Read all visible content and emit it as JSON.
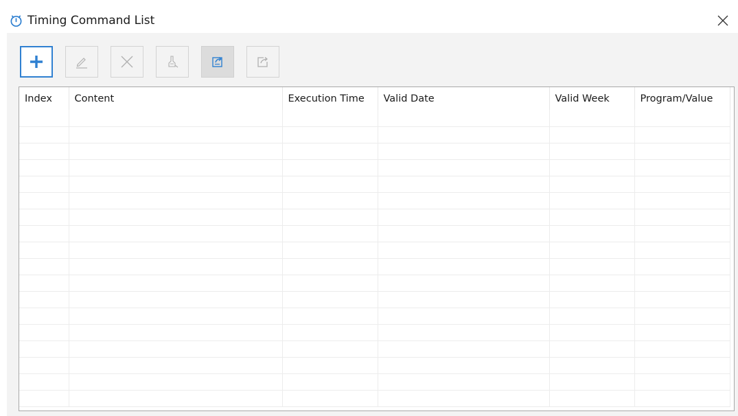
{
  "window": {
    "title": "Timing Command List",
    "close_label": "×"
  },
  "toolbar": {
    "buttons": [
      {
        "icon": "plus-icon",
        "state": "enabled-primary"
      },
      {
        "icon": "pencil-edit-icon",
        "state": "disabled"
      },
      {
        "icon": "delete-x-icon",
        "state": "disabled"
      },
      {
        "icon": "clear-brush-icon",
        "state": "disabled"
      },
      {
        "icon": "import-icon",
        "state": "active"
      },
      {
        "icon": "export-icon",
        "state": "disabled"
      }
    ]
  },
  "table": {
    "columns": [
      "Index",
      "Content",
      "Execution Time",
      "Valid Date",
      "Valid Week",
      "Program/Value"
    ],
    "rows": []
  },
  "colors": {
    "accent": "#2f80d1",
    "body_bg": "#f3f3f3",
    "grid_border": "#a8a8a8"
  }
}
